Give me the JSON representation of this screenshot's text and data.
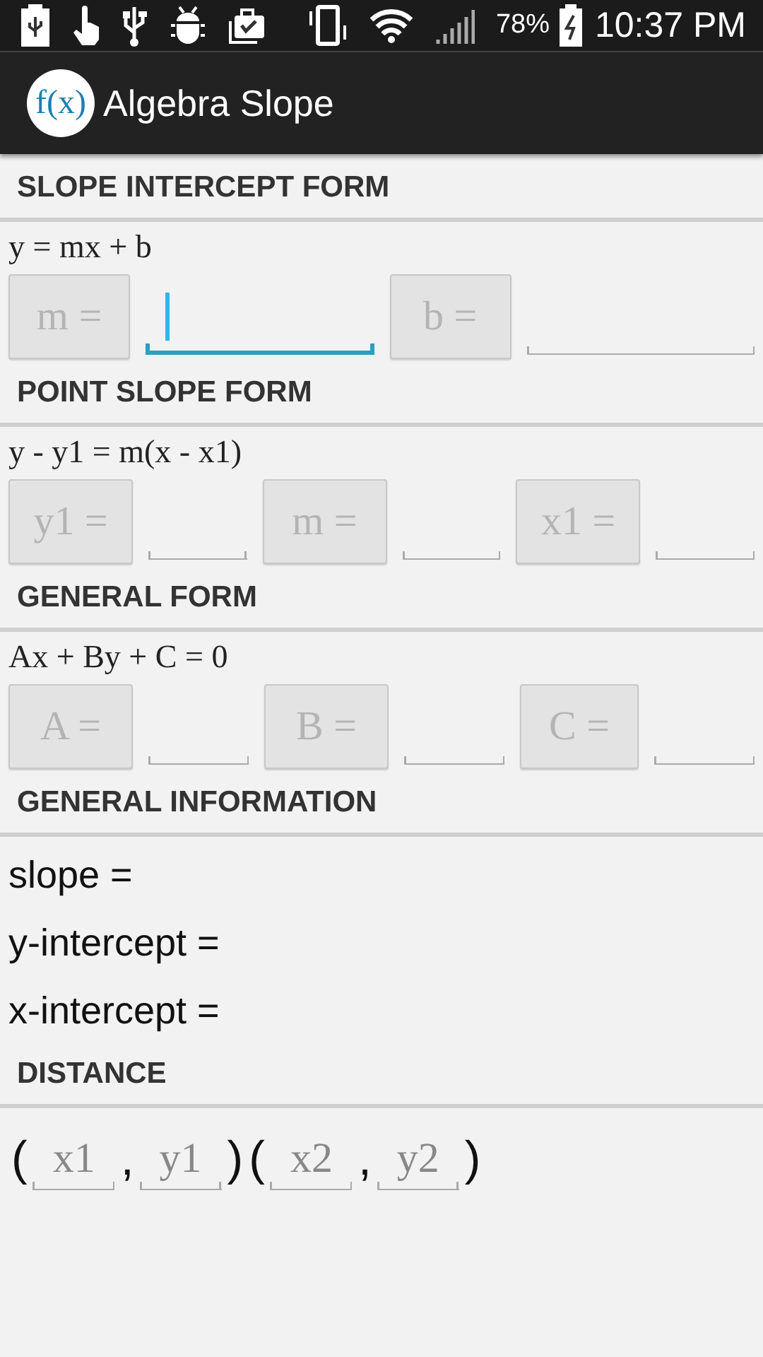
{
  "status_bar": {
    "battery": "78%",
    "time": "10:37 PM"
  },
  "app_bar": {
    "logo": "f(x)",
    "title": "Algebra Slope"
  },
  "sections": [
    {
      "kind": "form",
      "heading": "SLOPE INTERCEPT FORM",
      "formula": "y = mx + b",
      "pairs": [
        {
          "label": "m =",
          "focused": true
        },
        {
          "label": "b =",
          "focused": false
        }
      ]
    },
    {
      "kind": "form",
      "heading": "POINT SLOPE FORM",
      "formula": "y - y1 = m(x - x1)",
      "pairs": [
        {
          "label": "y1 =",
          "focused": false
        },
        {
          "label": "m =",
          "focused": false
        },
        {
          "label": "x1 =",
          "focused": false
        }
      ]
    },
    {
      "kind": "form",
      "heading": "GENERAL FORM",
      "formula": "Ax + By + C = 0",
      "pairs": [
        {
          "label": "A =",
          "focused": false
        },
        {
          "label": "B =",
          "focused": false
        },
        {
          "label": "C =",
          "focused": false
        }
      ]
    },
    {
      "kind": "info",
      "heading": "GENERAL INFORMATION",
      "lines": [
        "slope =",
        "y-intercept =",
        "x-intercept ="
      ]
    },
    {
      "kind": "distance",
      "heading": "DISTANCE",
      "parts": [
        {
          "kind": "symbol",
          "text": "("
        },
        {
          "kind": "field",
          "placeholder": "x1"
        },
        {
          "kind": "symbol",
          "text": ","
        },
        {
          "kind": "field",
          "placeholder": "y1"
        },
        {
          "kind": "symbol",
          "text": ")"
        },
        {
          "kind": "symbol",
          "text": "("
        },
        {
          "kind": "field",
          "placeholder": "x2"
        },
        {
          "kind": "symbol",
          "text": ","
        },
        {
          "kind": "field",
          "placeholder": "y2"
        },
        {
          "kind": "symbol",
          "text": ")"
        }
      ]
    }
  ]
}
